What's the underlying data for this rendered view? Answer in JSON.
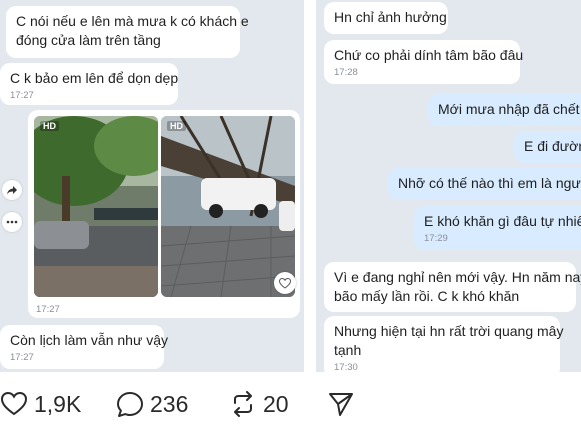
{
  "left_chat": {
    "messages": [
      {
        "text_lines": [
          "C nói nếu e lên mà mưa k có khách e",
          "đóng cửa làm trên tầng"
        ],
        "time": ""
      },
      {
        "text_lines": [
          "C k bảo em lên để dọn dẹp"
        ],
        "time": "17:27"
      },
      {
        "text_lines": [
          "Còn lịch làm vẫn như vậy"
        ],
        "time": "17:27"
      }
    ],
    "media": {
      "hd_label_1": "HD",
      "hd_label_2": "HD",
      "time": "17:27",
      "watermark": "@..."
    }
  },
  "right_chat": {
    "messages": [
      {
        "dir": "in",
        "text_lines": [
          "Hn chỉ ảnh hưởng"
        ],
        "time": ""
      },
      {
        "dir": "in",
        "text_lines": [
          "Chứ co phải dính tâm bão đâu"
        ],
        "time": "17:28"
      },
      {
        "dir": "out",
        "text_lines": [
          "Mới mưa nhập đã chết n"
        ],
        "time": ""
      },
      {
        "dir": "out",
        "text_lines": [
          "E đi đườn"
        ],
        "time": ""
      },
      {
        "dir": "out",
        "text_lines": [
          "Nhỡ có thế nào thì em là người"
        ],
        "time": ""
      },
      {
        "dir": "out",
        "text_lines": [
          "E khó khăn gì đâu tự nhiên"
        ],
        "time": "17:29"
      },
      {
        "dir": "in",
        "text_lines": [
          "Vì e đang nghỉ nên mới vậy. Hn năm nay",
          "bão mấy lần rồi. C k khó khăn"
        ],
        "time": ""
      },
      {
        "dir": "in",
        "text_lines": [
          "Nhưng hiện tại hn rất trời quang mây",
          "tạnh"
        ],
        "time": "17:30"
      }
    ]
  },
  "actions": {
    "likes": "1,9K",
    "comments": "236",
    "reposts": "20"
  },
  "icons": [
    "share-arrow-icon",
    "more-dots-icon",
    "heart-icon",
    "comment-icon",
    "repost-icon",
    "send-icon"
  ],
  "colors": {
    "chat_bg": "#e3e8ee",
    "bubble_in": "#ffffff",
    "bubble_out": "#d8ebff"
  }
}
